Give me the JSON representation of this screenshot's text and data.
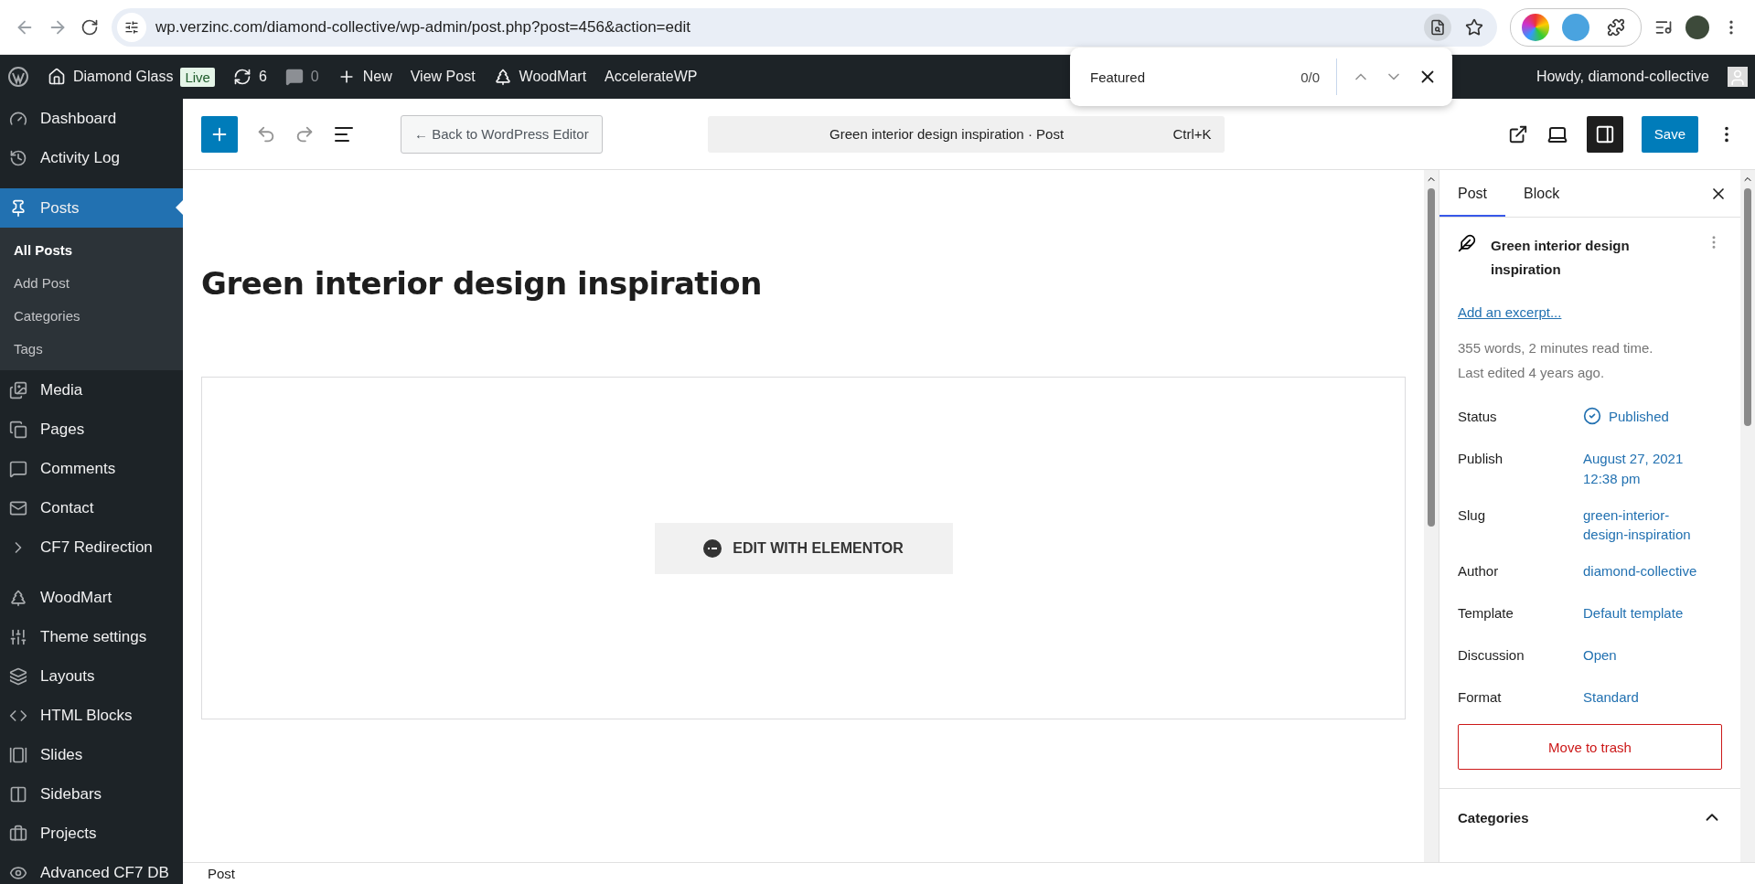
{
  "browser": {
    "url": "wp.verzinc.com/diamond-collective/wp-admin/post.php?post=456&action=edit",
    "find_bar": {
      "query": "Featured",
      "count": "0/0"
    }
  },
  "admin_bar": {
    "items": [
      {
        "kind": "site",
        "label": "Diamond Glass"
      },
      {
        "kind": "badge",
        "label": "Live"
      },
      {
        "kind": "updates",
        "label": "6"
      },
      {
        "kind": "comments",
        "label": "0"
      },
      {
        "kind": "new",
        "label": "New"
      },
      {
        "kind": "link",
        "label": "View Post"
      },
      {
        "kind": "woodmart",
        "label": "WoodMart"
      },
      {
        "kind": "link",
        "label": "AccelerateWP"
      }
    ],
    "howdy": "Howdy, diamond-collective"
  },
  "sidebar": {
    "sections": [
      {
        "items": [
          {
            "label": "Dashboard",
            "selected": false
          },
          {
            "label": "Activity Log",
            "selected": false
          }
        ]
      },
      {
        "items": [
          {
            "label": "Posts",
            "selected": true,
            "children": [
              {
                "label": "All Posts",
                "selected": true
              },
              {
                "label": "Add Post",
                "selected": false
              },
              {
                "label": "Categories",
                "selected": false
              },
              {
                "label": "Tags",
                "selected": false
              }
            ]
          },
          {
            "label": "Media",
            "selected": false
          },
          {
            "label": "Pages",
            "selected": false
          },
          {
            "label": "Comments",
            "selected": false
          },
          {
            "label": "Contact",
            "selected": false
          },
          {
            "label": "CF7 Redirection",
            "selected": false
          }
        ]
      },
      {
        "items": [
          {
            "label": "WoodMart",
            "selected": false
          },
          {
            "label": "Theme settings",
            "selected": false
          },
          {
            "label": "Layouts",
            "selected": false
          },
          {
            "label": "HTML Blocks",
            "selected": false
          },
          {
            "label": "Slides",
            "selected": false
          },
          {
            "label": "Sidebars",
            "selected": false
          },
          {
            "label": "Projects",
            "selected": false
          },
          {
            "label": "Advanced CF7 DB",
            "selected": false
          }
        ]
      }
    ]
  },
  "editor_header": {
    "back_button": "← Back to WordPress Editor",
    "command": {
      "title": "Green interior design inspiration · Post",
      "shortcut": "Ctrl+K"
    },
    "save": "Save"
  },
  "canvas": {
    "title": "Green interior design inspiration",
    "elementor_button": "EDIT WITH ELEMENTOR"
  },
  "panel": {
    "tabs": [
      {
        "label": "Post",
        "selected": true
      },
      {
        "label": "Block",
        "selected": false
      }
    ],
    "post_title": "Green interior design inspiration",
    "excerpt_link": "Add an excerpt...",
    "stats": [
      "355 words, 2 minutes read time.",
      "Last edited 4 years ago."
    ],
    "fields": [
      {
        "kind": "status",
        "label": "Status",
        "value": "Published"
      },
      {
        "kind": "plain",
        "label": "Publish",
        "value": "August 27, 2021 12:38 pm"
      },
      {
        "kind": "plain",
        "label": "Slug",
        "value": "green-interior-design-inspiration"
      },
      {
        "kind": "plain",
        "label": "Author",
        "value": "diamond-collective"
      },
      {
        "kind": "plain",
        "label": "Template",
        "value": "Default template"
      },
      {
        "kind": "plain",
        "label": "Discussion",
        "value": "Open"
      },
      {
        "kind": "plain",
        "label": "Format",
        "value": "Standard"
      }
    ],
    "trash_button": "Move to trash",
    "categories": {
      "title": "Categories",
      "expanded": true
    }
  },
  "footer": {
    "breadcrumb": "Post"
  }
}
